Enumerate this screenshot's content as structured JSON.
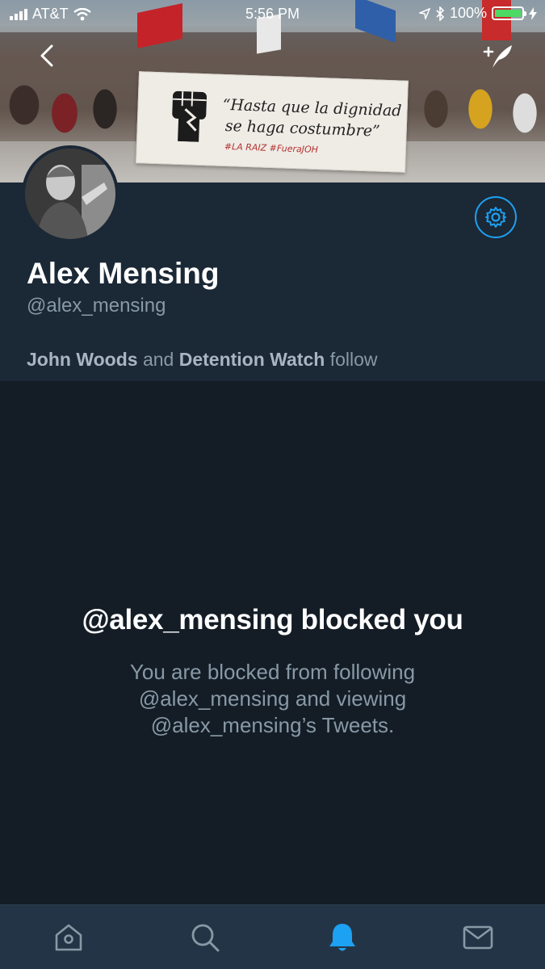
{
  "status_bar": {
    "carrier": "AT&T",
    "time": "5:56 PM",
    "battery": "100%"
  },
  "header": {
    "banner_sign": {
      "line1": "“Hasta que la dignidad",
      "line2": "se haga costumbre”",
      "tags": "#LA RAIZ  #FueraJOH"
    }
  },
  "profile": {
    "name": "Alex Mensing",
    "handle": "@alex_mensing",
    "followed_by": {
      "user1": "John Woods",
      "and": "and",
      "user2": "Detention Watch",
      "suffix": "follow"
    }
  },
  "blocked": {
    "title": "@alex_mensing blocked you",
    "line1": "You are blocked from following",
    "line2": "@alex_mensing and viewing",
    "line3": "@alex_mensing’s Tweets."
  },
  "tabbar": {
    "icons": [
      "home-icon",
      "search-icon",
      "notifications-icon",
      "messages-icon"
    ],
    "active": "notifications-icon"
  },
  "colors": {
    "accent": "#1da1f2",
    "background": "#141d26",
    "profile_background": "#1b2836",
    "secondary_text": "#8899a6",
    "tabbar_background": "#243447"
  }
}
